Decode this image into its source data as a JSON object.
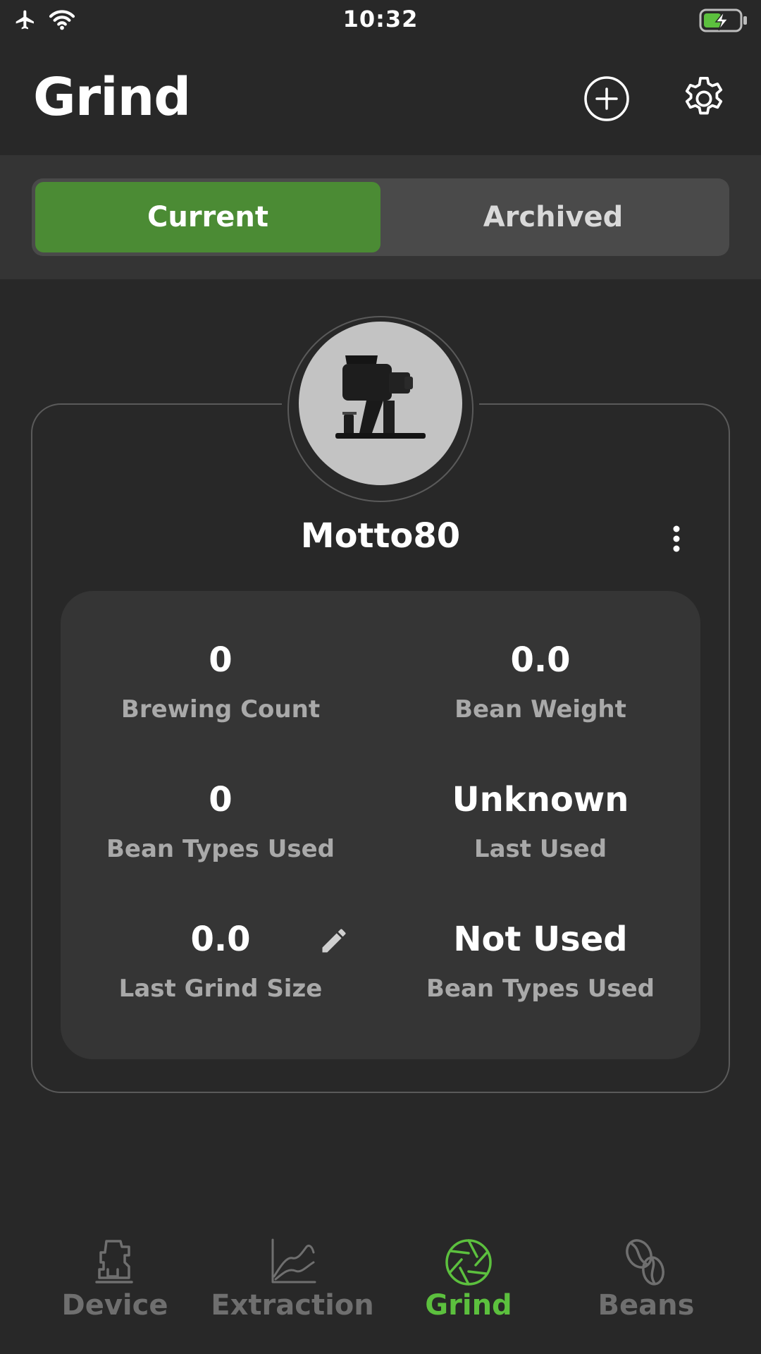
{
  "status_bar": {
    "time": "10:32"
  },
  "header": {
    "title": "Grind"
  },
  "segment": {
    "tabs": [
      "Current",
      "Archived"
    ],
    "selected": "Current"
  },
  "device": {
    "name": "Motto80",
    "stats": {
      "brewing_count": {
        "value": "0",
        "label": "Brewing Count"
      },
      "bean_weight": {
        "value": "0.0",
        "label": "Bean Weight"
      },
      "bean_types_used": {
        "value": "0",
        "label": "Bean Types Used"
      },
      "last_used": {
        "value": "Unknown",
        "label": "Last Used"
      },
      "last_grind_size": {
        "value": "0.0",
        "label": "Last Grind Size"
      },
      "bean_types_used_2": {
        "value": "Not Used",
        "label": "Bean Types Used"
      }
    }
  },
  "nav": {
    "items": [
      "Device",
      "Extraction",
      "Grind",
      "Beans"
    ],
    "active": "Grind"
  },
  "colors": {
    "accent": "#4b8b34",
    "nav_active": "#5cc03e",
    "background": "#282828",
    "card_inner": "#353535"
  },
  "icons": {
    "status_left": [
      "airplane-icon",
      "wifi-icon"
    ],
    "status_right": [
      "battery-charging-icon"
    ],
    "header": [
      "add-circle-icon",
      "gear-icon"
    ],
    "card": [
      "grinder-image",
      "more-vertical-icon",
      "pencil-icon"
    ],
    "nav": [
      "espresso-machine-icon",
      "chart-line-icon",
      "aperture-icon",
      "coffee-beans-icon"
    ]
  }
}
